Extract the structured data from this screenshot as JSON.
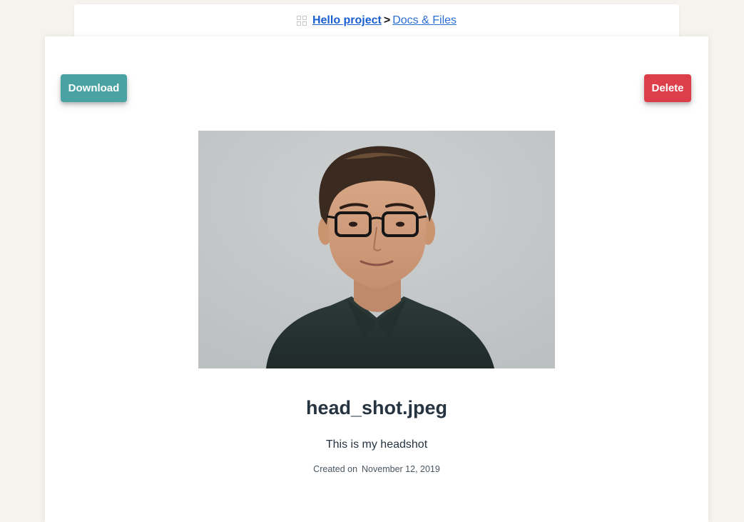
{
  "breadcrumb": {
    "icon": "grid-icon",
    "project": "Hello project",
    "separator": ">",
    "section": "Docs & Files"
  },
  "actions": {
    "download_label": "Download",
    "delete_label": "Delete"
  },
  "file": {
    "image_subject": "portrait-photo",
    "name": "head_shot.jpeg",
    "description": "This is my headshot",
    "created_label": "Created on",
    "created_date": "November 12, 2019"
  },
  "colors": {
    "download": "#4aa3a2",
    "delete": "#dc3e4a",
    "link": "#1a5fd1",
    "background": "#f6f2ee"
  }
}
